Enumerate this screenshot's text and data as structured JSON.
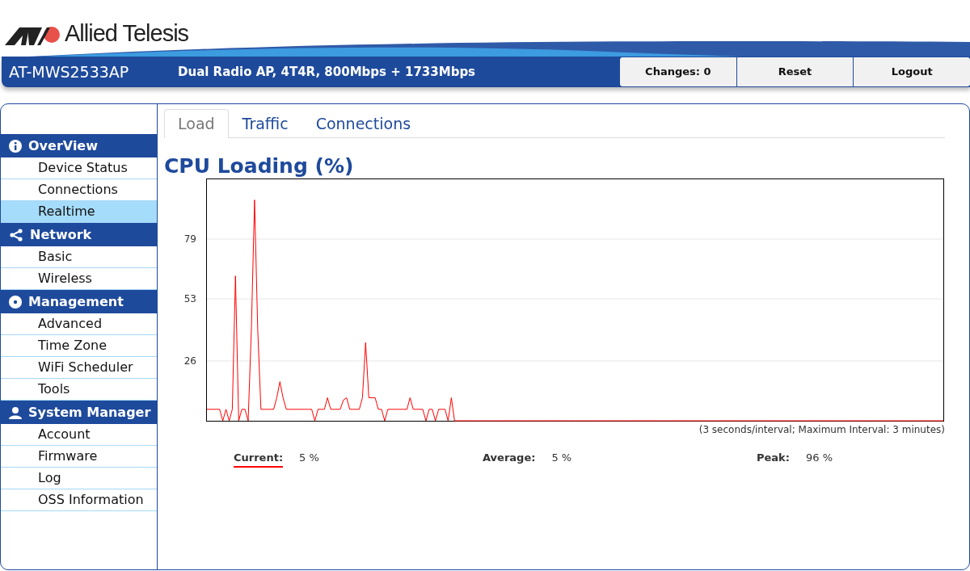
{
  "header": {
    "brand": "Allied Telesis",
    "model": "AT-MWS2533AP",
    "description": "Dual Radio AP, 4T4R, 800Mbps + 1733Mbps",
    "buttons": [
      "Changes: 0",
      "Reset",
      "Logout"
    ]
  },
  "sidebar": [
    {
      "title": "OverView",
      "items": [
        {
          "label": "Device Status",
          "selected": false
        },
        {
          "label": "Connections",
          "selected": false
        },
        {
          "label": "Realtime",
          "selected": true
        }
      ]
    },
    {
      "title": "Network",
      "items": [
        {
          "label": "Basic",
          "selected": false
        },
        {
          "label": "Wireless",
          "selected": false
        }
      ]
    },
    {
      "title": "Management",
      "items": [
        {
          "label": "Advanced",
          "selected": false
        },
        {
          "label": "Time Zone",
          "selected": false
        },
        {
          "label": "WiFi Scheduler",
          "selected": false
        },
        {
          "label": "Tools",
          "selected": false
        }
      ]
    },
    {
      "title": "System Manager",
      "items": [
        {
          "label": "Account",
          "selected": false
        },
        {
          "label": "Firmware",
          "selected": false
        },
        {
          "label": "Log",
          "selected": false
        },
        {
          "label": "OSS Information",
          "selected": false
        }
      ]
    }
  ],
  "tabs": [
    {
      "label": "Load",
      "selected": true
    },
    {
      "label": "Traffic",
      "selected": false
    },
    {
      "label": "Connections",
      "selected": false
    }
  ],
  "panel": {
    "title": "CPU Loading (%)",
    "chart_data": {
      "type": "line",
      "ylim": [
        0,
        105
      ],
      "grid": true,
      "yticks": [
        26,
        53,
        79
      ],
      "series": [
        {
          "color": "#ff0000",
          "values": [
            5,
            5,
            5,
            5,
            5,
            0,
            5,
            0,
            5,
            63,
            0,
            5,
            5,
            0,
            40,
            96,
            40,
            5,
            5,
            5,
            5,
            5,
            10,
            17,
            10,
            5,
            5,
            5,
            5,
            5,
            5,
            5,
            5,
            5,
            0,
            5,
            5,
            5,
            10,
            5,
            5,
            5,
            5,
            9,
            10,
            5,
            5,
            5,
            5,
            10,
            34,
            10,
            10,
            10,
            5,
            5,
            0,
            5,
            5,
            5,
            5,
            5,
            5,
            5,
            10,
            5,
            5,
            5,
            5,
            0,
            5,
            5,
            0,
            5,
            5,
            5,
            0,
            10,
            0,
            0,
            0,
            0,
            0,
            0,
            0,
            0,
            0,
            0,
            0,
            0,
            0,
            0,
            0,
            0,
            0,
            0,
            0,
            0,
            0,
            0,
            0,
            0,
            0,
            0,
            0,
            0,
            0,
            0,
            0,
            0,
            0,
            0,
            0,
            0,
            0,
            0,
            0,
            0,
            0,
            0,
            0,
            0,
            0,
            0,
            0,
            0,
            0,
            0,
            0,
            0,
            0,
            0,
            0,
            0,
            0,
            0,
            0,
            0,
            0,
            0,
            0,
            0,
            0,
            0,
            0,
            0,
            0,
            0,
            0,
            0,
            0,
            0,
            0,
            0,
            0,
            0,
            0,
            0,
            0,
            0,
            0,
            0,
            0,
            0,
            0,
            0,
            0,
            0,
            0,
            0,
            0,
            0,
            0,
            0,
            0,
            0,
            0,
            0,
            0,
            0,
            0,
            0,
            0,
            0,
            0,
            0,
            0,
            0,
            0,
            0,
            0,
            0,
            0,
            0,
            0,
            0,
            0,
            0,
            0,
            0,
            0,
            0,
            0,
            0,
            0,
            0,
            0,
            0,
            0,
            0,
            0,
            0,
            0,
            0,
            0,
            0,
            0,
            0,
            0,
            0,
            0,
            0,
            0,
            0,
            0,
            0,
            0,
            0,
            0,
            0,
            0,
            0,
            0
          ]
        }
      ]
    },
    "note": "(3 seconds/interval; Maximum Interval: 3 minutes)",
    "stats": [
      {
        "label": "Current:",
        "value": "5 %",
        "line_key": true
      },
      {
        "label": "Average:",
        "value": "5 %",
        "line_key": false
      },
      {
        "label": "Peak:",
        "value": "96 %",
        "line_key": false
      }
    ]
  }
}
